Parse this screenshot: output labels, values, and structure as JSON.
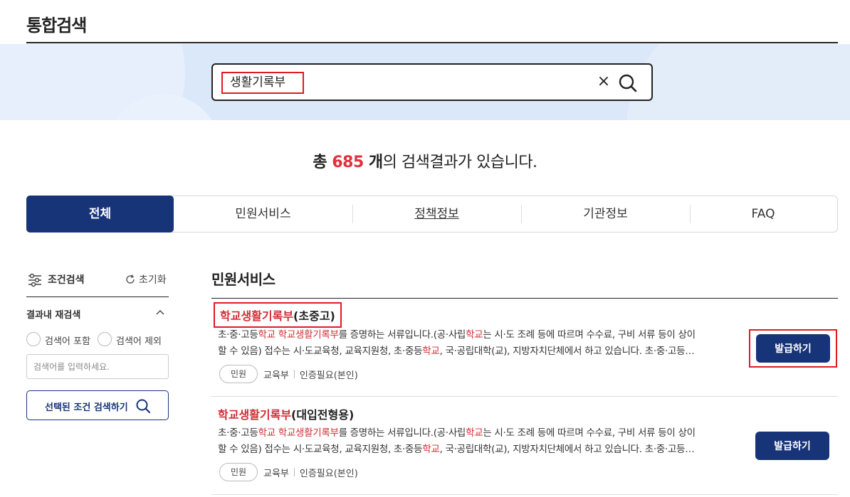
{
  "page_title": "통합검색",
  "search": {
    "value": "생활기록부",
    "clear_glyph": "×"
  },
  "summary": {
    "prefix": "총 ",
    "count": "685",
    "unit": " 개",
    "suffix": "의 검색결과가 있습니다."
  },
  "tabs": [
    {
      "label": "전체",
      "active": true
    },
    {
      "label": "민원서비스",
      "active": false
    },
    {
      "label": "정책정보",
      "active": false
    },
    {
      "label": "기관정보",
      "active": false
    },
    {
      "label": "FAQ",
      "active": false
    }
  ],
  "sidebar": {
    "title": "조건검색",
    "reset_label": "초기화",
    "refine_title": "결과내 재검색",
    "radio_include": "검색어 포함",
    "radio_exclude": "검색어 제외",
    "input_placeholder": "검색어를 입력하세요.",
    "submit_label": "선택된 조건 검색하기"
  },
  "section_title": "민원서비스",
  "results": [
    {
      "title_hl": "학교생활기록부",
      "title_rest": "(초중고)",
      "desc_line1": [
        [
          "초·중·고등",
          false
        ],
        [
          "학교",
          true
        ],
        [
          " ",
          false
        ],
        [
          "학교생활기록부",
          true
        ],
        [
          "를 증명하는 서류입니다.(공·사립",
          false
        ],
        [
          "학교",
          true
        ],
        [
          "는 시·도 조례 등에 따르며 수수료, 구비 서류 등이 상이",
          false
        ]
      ],
      "desc_line2": [
        [
          "할 수 있음) 접수는 시·도교육청, 교육지원청, 초·중등",
          false
        ],
        [
          "학교",
          true
        ],
        [
          ", 국·공립대학(교), 지방자치단체에서 하고 있습니다. 초·중·고등…",
          false
        ]
      ],
      "tag": "민원",
      "agency": "교육부",
      "auth": "인증필요(본인)",
      "button": "발급하기"
    },
    {
      "title_hl": "학교생활기록부",
      "title_rest": "(대입전형용)",
      "desc_line1": [
        [
          "초·중·고등",
          false
        ],
        [
          "학교",
          true
        ],
        [
          " ",
          false
        ],
        [
          "학교생활기록부",
          true
        ],
        [
          "를 증명하는 서류입니다.(공·사립",
          false
        ],
        [
          "학교",
          true
        ],
        [
          "는 시·도 조례 등에 따르며 수수료, 구비 서류 등이 상이",
          false
        ]
      ],
      "desc_line2": [
        [
          "할 수 있음) 접수는 시·도교육청, 교육지원청, 초·중등",
          false
        ],
        [
          "학교",
          true
        ],
        [
          ", 국·공립대학(교), 지방자치단체에서 하고 있습니다. 초·중·고등…",
          false
        ]
      ],
      "tag": "민원",
      "agency": "교육부",
      "auth": "인증필요(본인)",
      "button": "발급하기"
    }
  ],
  "colors": {
    "primary": "#173479",
    "highlight": "#d12d33",
    "count": "#e0313b",
    "band": "#dbe8fa"
  }
}
